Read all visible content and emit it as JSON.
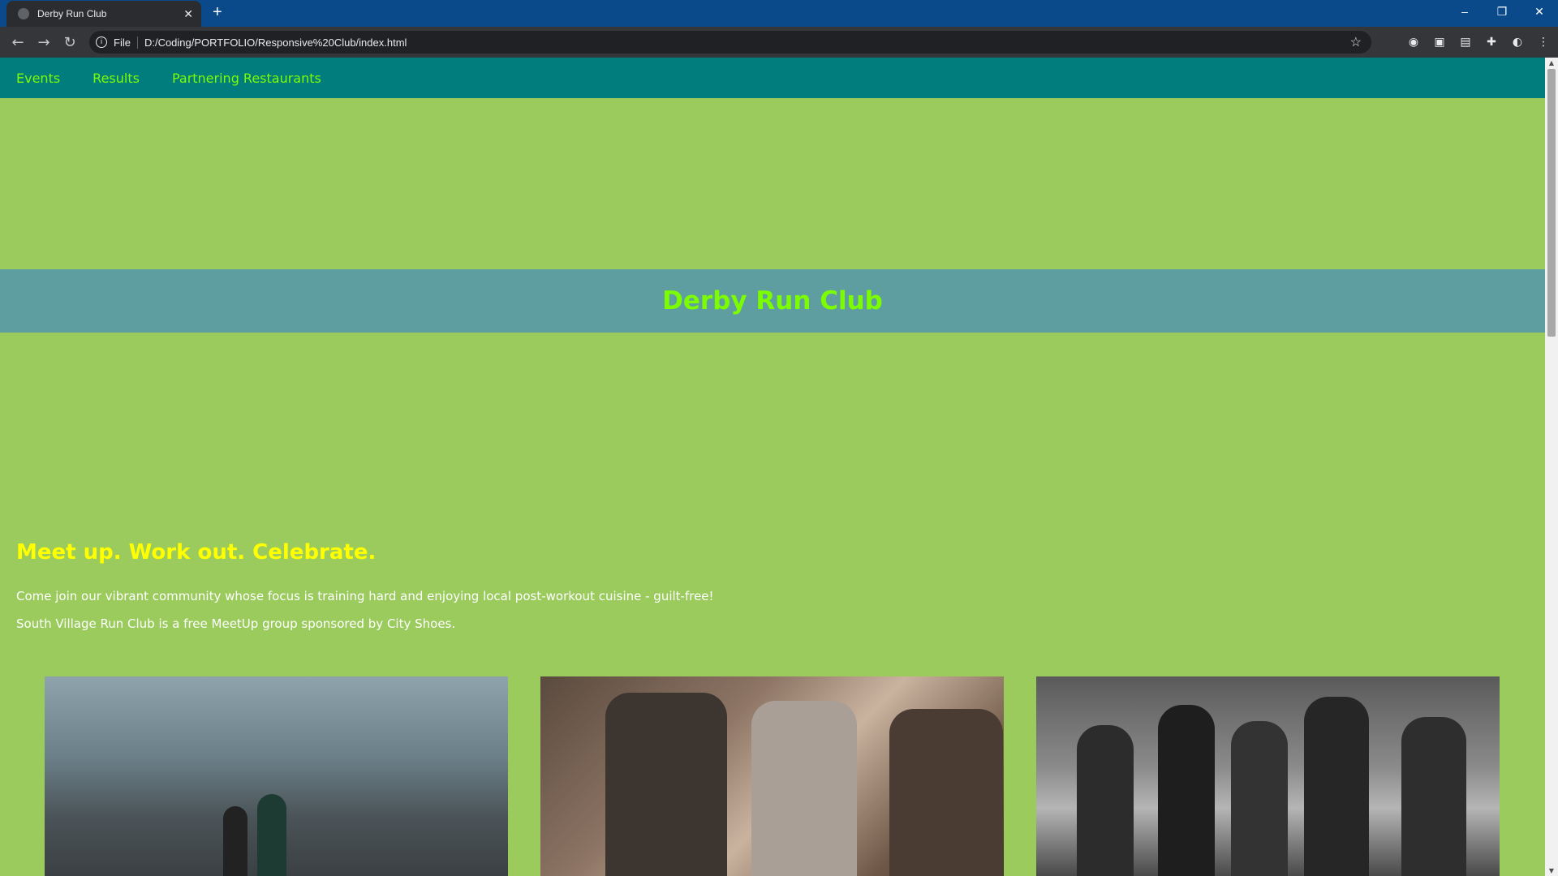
{
  "browser": {
    "tab_title": "Derby Run Club",
    "tab_close": "✕",
    "new_tab": "+",
    "url_scheme": "File",
    "url": "D:/Coding/PORTFOLIO/Responsive%20Club/index.html",
    "window_controls": {
      "minimize": "–",
      "restore": "❐",
      "close": "✕"
    }
  },
  "site": {
    "nav": [
      "Events",
      "Results",
      "Partnering Restaurants"
    ],
    "title": "Derby Run Club",
    "tagline": "Meet up. Work out. Celebrate.",
    "paragraphs": [
      "Come join our vibrant community whose focus is training hard and enjoying local post-workout cuisine - guilt-free!",
      "South Village Run Club is a free MeetUp group sponsored by City Shoes."
    ]
  },
  "colors": {
    "page_bg": "#9acb5c",
    "nav_bg": "#017d7d",
    "nav_link": "#7cfc00",
    "banner_bg": "#5f9ea0",
    "tagline": "#ffff00"
  }
}
